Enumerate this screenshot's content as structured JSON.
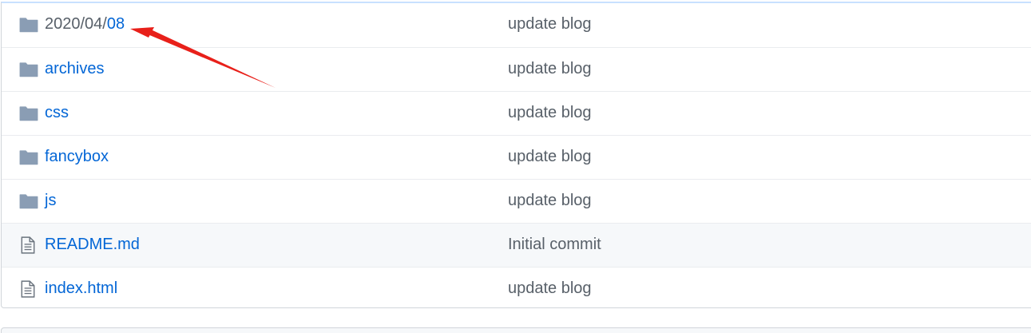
{
  "files": [
    {
      "name_prefix": "2020/04/",
      "name_link": "08",
      "message": "update blog",
      "icon": "folder-icon"
    },
    {
      "name_prefix": "",
      "name_link": "archives",
      "message": "update blog",
      "icon": "folder-icon"
    },
    {
      "name_prefix": "",
      "name_link": "css",
      "message": "update blog",
      "icon": "folder-icon"
    },
    {
      "name_prefix": "",
      "name_link": "fancybox",
      "message": "update blog",
      "icon": "folder-icon"
    },
    {
      "name_prefix": "",
      "name_link": "js",
      "message": "update blog",
      "icon": "folder-icon"
    },
    {
      "name_prefix": "",
      "name_link": "README.md",
      "message": "Initial commit",
      "icon": "file-icon"
    },
    {
      "name_prefix": "",
      "name_link": "index.html",
      "message": "update blog",
      "icon": "file-icon"
    }
  ],
  "colors": {
    "link": "#0366d6",
    "muted_text": "#586069",
    "folder_icon": "#79b8ff",
    "annotation_arrow": "#e8201a"
  }
}
